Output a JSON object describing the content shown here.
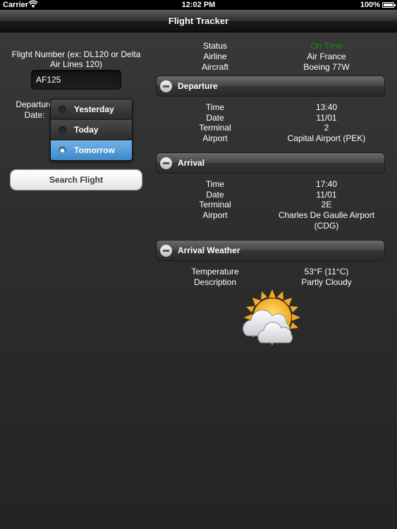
{
  "status_bar": {
    "carrier": "Carrier",
    "time": "12:02 PM",
    "battery": "100%"
  },
  "nav": {
    "title": "Flight Tracker"
  },
  "search": {
    "flight_label": "Flight Number (ex: DL120 or Delta Air Lines 120)",
    "flight_value": "AF125",
    "date_label": "Departure Date:",
    "date_options": [
      "Yesterday",
      "Today",
      "Tomorrow"
    ],
    "selected_date": "Tomorrow",
    "button": "Search Flight"
  },
  "summary": [
    {
      "label": "Status",
      "value": "On Time",
      "color": "#1a8c1a"
    },
    {
      "label": "Airline",
      "value": "Air France"
    },
    {
      "label": "Aircraft",
      "value": "Boeing 77W"
    }
  ],
  "departure": {
    "header": "Departure",
    "rows": [
      {
        "label": "Time",
        "value": "13:40"
      },
      {
        "label": "Date",
        "value": "11/01"
      },
      {
        "label": "Terminal",
        "value": "2"
      },
      {
        "label": "Airport",
        "value": "Capital Airport (PEK)"
      }
    ]
  },
  "arrival": {
    "header": "Arrival",
    "rows": [
      {
        "label": "Time",
        "value": "17:40"
      },
      {
        "label": "Date",
        "value": "11/01"
      },
      {
        "label": "Terminal",
        "value": "2E"
      },
      {
        "label": "Airport",
        "value": "Charles De Gaulle Airport (CDG)"
      }
    ]
  },
  "weather": {
    "header": "Arrival Weather",
    "rows": [
      {
        "label": "Temperature",
        "value": "53°F (11°C)"
      },
      {
        "label": "Description",
        "value": "Partly Cloudy"
      }
    ],
    "icon": "partly-cloudy-icon"
  }
}
